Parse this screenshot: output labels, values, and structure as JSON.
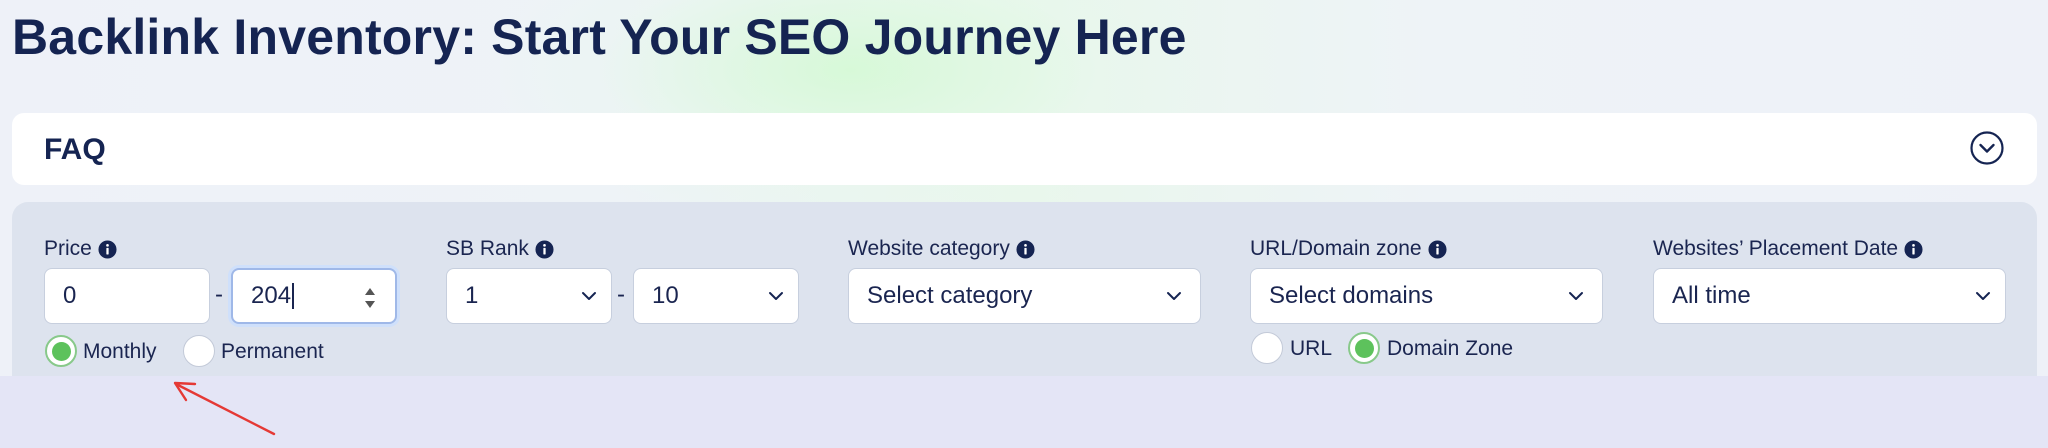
{
  "page": {
    "title": "Backlink Inventory: Start Your SEO Journey Here"
  },
  "faq": {
    "label": "FAQ"
  },
  "filters": {
    "price": {
      "label": "Price",
      "min_value": "0",
      "max_value": "204",
      "options": [
        {
          "label": "Monthly",
          "checked": true
        },
        {
          "label": "Permanent",
          "checked": false
        }
      ]
    },
    "sb_rank": {
      "label": "SB Rank",
      "min_value": "1",
      "max_value": "10"
    },
    "website_category": {
      "label": "Website category",
      "placeholder": "Select category"
    },
    "domain_zone": {
      "label": "URL/Domain zone",
      "placeholder": "Select domains",
      "options": [
        {
          "label": "URL",
          "checked": false
        },
        {
          "label": "Domain Zone",
          "checked": true
        }
      ]
    },
    "placement_date": {
      "label": "Websites’ Placement Date",
      "value": "All time"
    }
  },
  "colors": {
    "title": "#152452",
    "radio_checked": "#5dc25c",
    "annotation_arrow": "#e53935"
  }
}
